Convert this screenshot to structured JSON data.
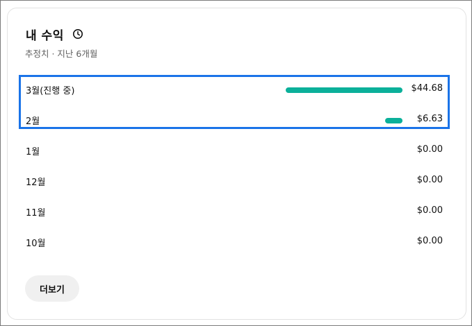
{
  "header": {
    "title": "내 수익",
    "subtitle": "추정치 · 지난 6개월",
    "icon": "clock-icon"
  },
  "earnings": {
    "max_value": 44.68,
    "bar_color": "#0bb09a",
    "highlight_color": "#1a73e8",
    "rows": [
      {
        "label": "3월(진행 중)",
        "amount": "$44.68",
        "value": 44.68
      },
      {
        "label": "2월",
        "amount": "$6.63",
        "value": 6.63
      },
      {
        "label": "1월",
        "amount": "$0.00",
        "value": 0
      },
      {
        "label": "12월",
        "amount": "$0.00",
        "value": 0
      },
      {
        "label": "11월",
        "amount": "$0.00",
        "value": 0
      },
      {
        "label": "10월",
        "amount": "$0.00",
        "value": 0
      }
    ]
  },
  "actions": {
    "more_label": "더보기"
  }
}
